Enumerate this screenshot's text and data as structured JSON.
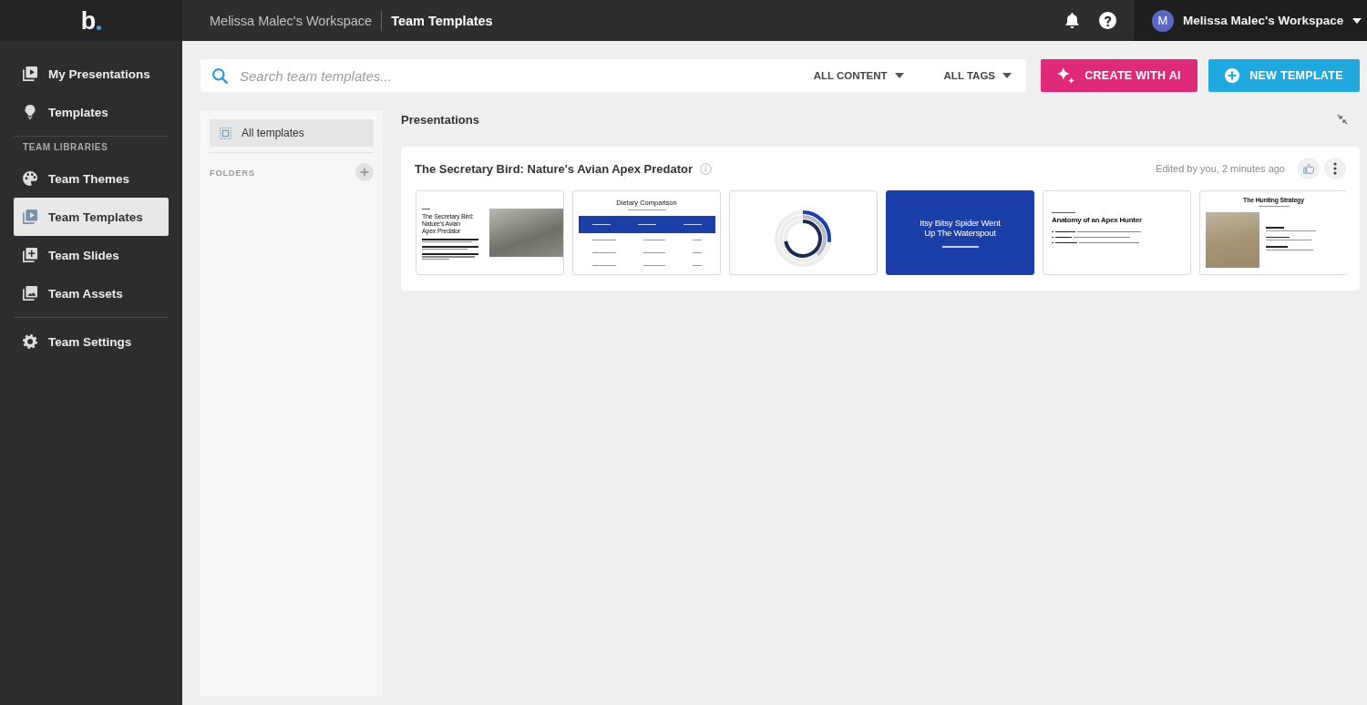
{
  "brand": {
    "logo": "b"
  },
  "topbar": {
    "breadcrumb": [
      {
        "label": "Melissa Malec's Workspace",
        "current": false
      },
      {
        "label": "Team Templates",
        "current": true
      }
    ],
    "account": {
      "initial": "M",
      "name": "Melissa Malec's Workspace"
    }
  },
  "sidebar": {
    "sections": [
      {
        "items": [
          {
            "label": "My Presentations",
            "selected": false
          },
          {
            "label": "Templates",
            "selected": false
          }
        ]
      },
      {
        "heading": "TEAM LIBRARIES",
        "items": [
          {
            "label": "Team Themes",
            "selected": false
          },
          {
            "label": "Team Templates",
            "selected": true
          },
          {
            "label": "Team Slides",
            "selected": false
          },
          {
            "label": "Team Assets",
            "selected": false
          }
        ]
      },
      {
        "items": [
          {
            "label": "Team Settings",
            "selected": false
          }
        ]
      }
    ]
  },
  "toolbar": {
    "search": {
      "placeholder": "Search team templates..."
    },
    "filters": [
      {
        "label": "ALL CONTENT"
      },
      {
        "label": "ALL TAGS"
      }
    ],
    "actions": [
      {
        "kind": "ai",
        "label": "CREATE WITH AI"
      },
      {
        "kind": "new",
        "label": "NEW TEMPLATE"
      }
    ]
  },
  "folders": {
    "items": [
      {
        "label": "All templates",
        "selected": true
      }
    ],
    "heading": "FOLDERS"
  },
  "content": {
    "heading": "Presentations",
    "presentations": [
      {
        "title": "The Secretary Bird: Nature's Avian Apex Predator",
        "edited": "Edited by you, 2 minutes ago",
        "slides": [
          {
            "kind": "title-photo",
            "title": "The Secretary Bird: Nature's Avian Apex Predator"
          },
          {
            "kind": "table",
            "title": "Dietary Comparison"
          },
          {
            "kind": "chart"
          },
          {
            "kind": "cover",
            "title": "Itsy Bitsy Spider Went Up The Waterspout"
          },
          {
            "kind": "bullets",
            "title": "Anatomy of an Apex Hunter"
          },
          {
            "kind": "photo-bullets",
            "title": "The Hunting Strategy"
          }
        ]
      }
    ]
  }
}
